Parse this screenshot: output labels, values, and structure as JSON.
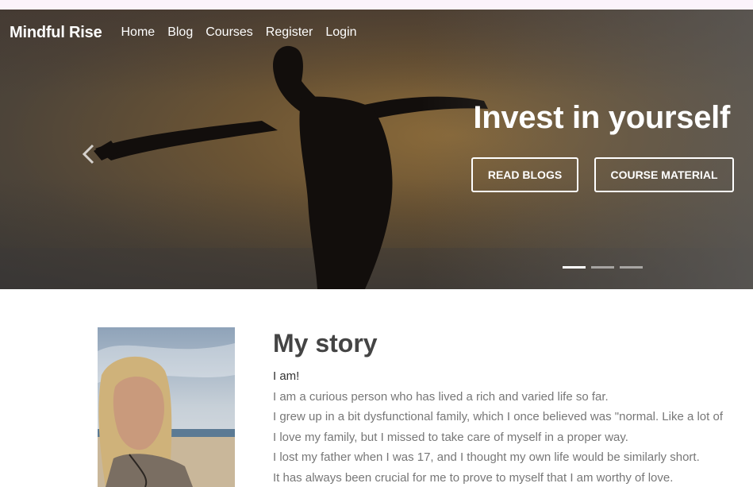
{
  "nav": {
    "brand": "Mindful Rise",
    "links": [
      "Home",
      "Blog",
      "Courses",
      "Register",
      "Login"
    ]
  },
  "hero": {
    "title": "Invest in yourself",
    "buttons": [
      "READ BLOGS",
      "COURSE MATERIAL"
    ],
    "slides": 3,
    "active_slide": 1
  },
  "story": {
    "title": "My story",
    "lines": [
      "I am!",
      "I am a curious person who has lived a rich and varied life so far.",
      "I grew up in a bit dysfunctional family, which I once believed was \"normal. Like a lot of",
      "I love my family, but I missed to take care of myself in a proper way.",
      "I lost my father when I was 17, and I thought my own life would be similarly short.",
      "It has always been crucial for me to prove to myself that I am worthy of love."
    ]
  }
}
